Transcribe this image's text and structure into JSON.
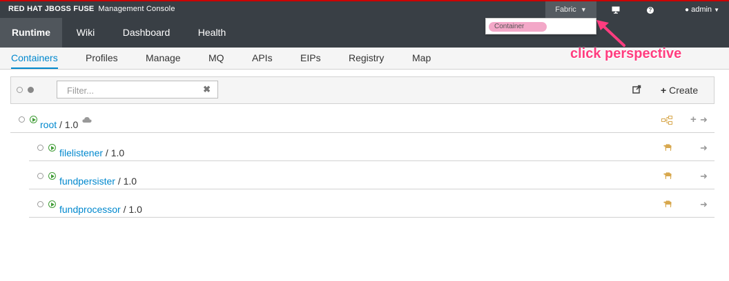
{
  "brand": {
    "title": "RED HAT JBOSS FUSE",
    "subtitle": "Management Console"
  },
  "topbar": {
    "perspective": "Fabric",
    "help": "?",
    "user": "admin"
  },
  "perspective_menu": {
    "items": [
      "Container"
    ]
  },
  "annotation": "click perspective",
  "nav": {
    "tabs": [
      "Runtime",
      "Wiki",
      "Dashboard",
      "Health"
    ]
  },
  "subnav": {
    "tabs": [
      "Containers",
      "Profiles",
      "Manage",
      "MQ",
      "APIs",
      "EIPs",
      "Registry",
      "Map"
    ]
  },
  "toolbar": {
    "filter_placeholder": "Filter...",
    "create_label": "Create"
  },
  "containers": [
    {
      "name": "root",
      "version": "/ 1.0"
    },
    {
      "name": "filelistener",
      "version": "/ 1.0"
    },
    {
      "name": "fundpersister",
      "version": "/ 1.0"
    },
    {
      "name": "fundprocessor",
      "version": "/ 1.0"
    }
  ],
  "colors": {
    "accent": "#0088ce",
    "header": "#393f45",
    "running": "#3f9c35",
    "annotation": "#ff3d7f"
  }
}
